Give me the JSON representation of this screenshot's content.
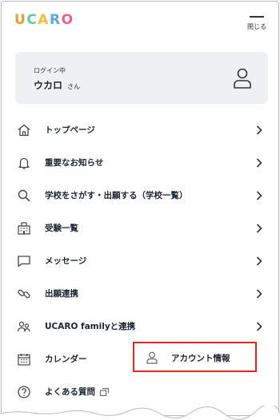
{
  "header": {
    "logo_letters": [
      {
        "char": "U",
        "color": "#f29a3b"
      },
      {
        "char": "C",
        "color": "#6cc3a2"
      },
      {
        "char": "A",
        "color": "#f4c13d"
      },
      {
        "char": "R",
        "color": "#5ea8dd"
      },
      {
        "char": "O",
        "color": "#e8608c"
      }
    ],
    "close_label": "閉じる"
  },
  "login": {
    "status": "ログイン中",
    "name": "ウカロ",
    "suffix": "さん"
  },
  "menu": {
    "items": [
      {
        "label": "トップページ",
        "icon": "home-icon"
      },
      {
        "label": "重要なお知らせ",
        "icon": "bell-icon"
      },
      {
        "label": "学校をさがす・出願する（学校一覧）",
        "icon": "search-icon"
      },
      {
        "label": "受験一覧",
        "icon": "school-building-icon"
      },
      {
        "label": "メッセージ",
        "icon": "message-icon"
      },
      {
        "label": "出願連携",
        "icon": "link-icon"
      },
      {
        "label": "UCARO familyと連携",
        "icon": "family-icon"
      },
      {
        "label": "カレンダー",
        "icon": "calendar-icon"
      },
      {
        "label": "よくある質問",
        "icon": "question-icon"
      }
    ]
  },
  "account_popup": {
    "label": "アカウント情報",
    "icon": "person-icon",
    "highlight_color": "#e0252a"
  }
}
